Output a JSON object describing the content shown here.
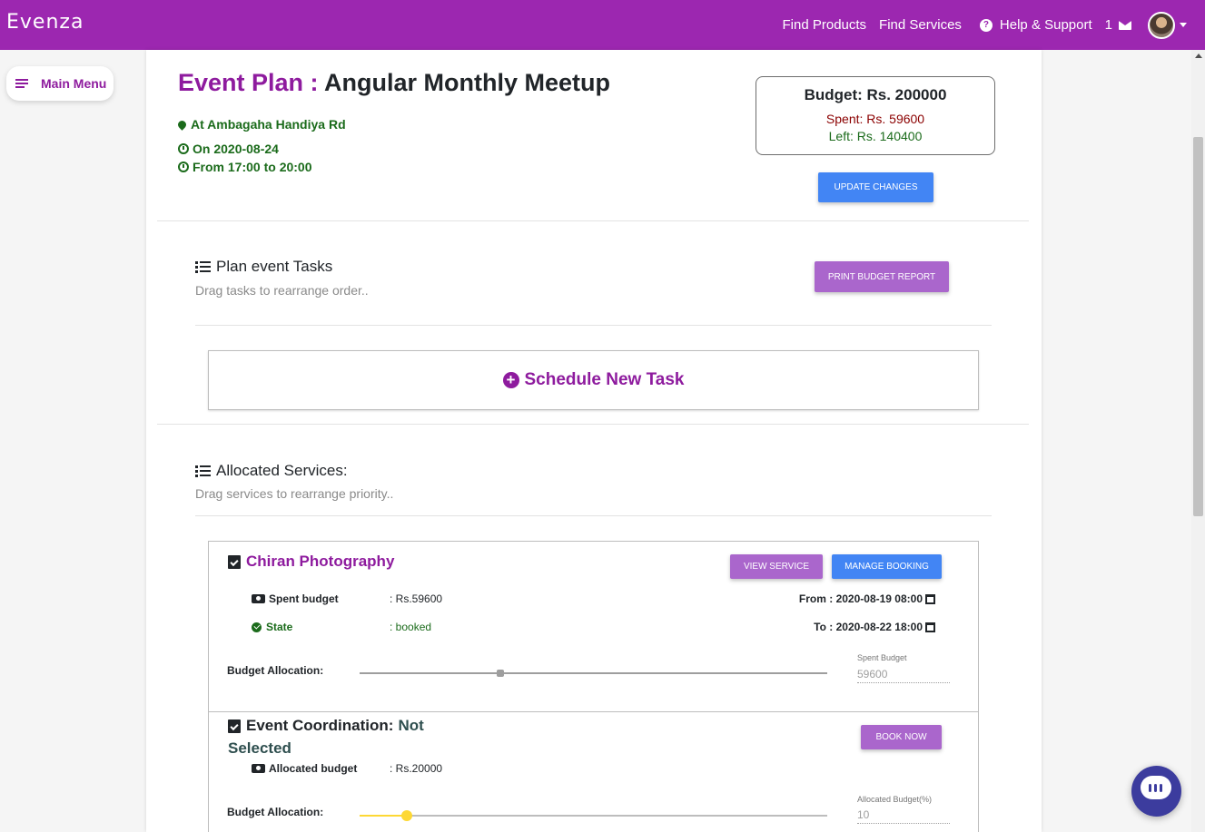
{
  "navbar": {
    "brand": "Evenza",
    "find_products": "Find Products",
    "find_services": "Find Services",
    "help": "Help & Support",
    "message_count": "1",
    "bg_color": "#9c27b0"
  },
  "main_menu": {
    "label": "Main Menu"
  },
  "event": {
    "title_label": "Event Plan :",
    "title_name": "Angular Monthly Meetup",
    "location": "At Ambagaha Handiya Rd",
    "date": "On 2020-08-24",
    "time": "From 17:00 to 20:00"
  },
  "budget": {
    "title": "Budget: Rs. 200000",
    "spent": "Spent: Rs. 59600",
    "left": "Left: Rs. 140400"
  },
  "buttons": {
    "update_changes": "UPDATE CHANGES",
    "print_budget_report": "PRINT BUDGET REPORT",
    "view_service": "VIEW SERVICE",
    "manage_booking": "MANAGE BOOKING",
    "book_now": "BOOK NOW"
  },
  "tasks": {
    "title": "Plan event Tasks",
    "subtitle": "Drag tasks to rearrange order..",
    "schedule_new": "Schedule New Task"
  },
  "services": {
    "title": "Allocated Services:",
    "subtitle": "Drag services to rearrange priority..",
    "items": [
      {
        "name": "Chiran Photography",
        "spent_label": "Spent budget",
        "spent_value": ": Rs.59600",
        "state_label": "State",
        "state_value": ": booked",
        "from": "From : 2020-08-19 08:00",
        "to": "To : 2020-08-22 18:00",
        "allocation_label": "Budget Allocation:",
        "allocation_level": 0.3,
        "input_label": "Spent Budget",
        "input_value": "59600"
      },
      {
        "name_prefix": "Event Coordination:",
        "name_status_1": "Not",
        "name_status_2": "Selected",
        "allocated_label": "Allocated budget",
        "allocated_value": ": Rs.20000",
        "allocation_label": "Budget Allocation:",
        "allocation_level": 0.1,
        "input_label": "Allocated Budget(%)",
        "input_value": "10"
      }
    ]
  },
  "colors": {
    "accent": "#8e1b9e",
    "success": "#1b6b1b",
    "danger": "#8b0000",
    "primary_button": "#4285f4",
    "secondary_button": "#aa66cc",
    "chat": "#3c3c9e",
    "slider_active": "#fdd835"
  }
}
